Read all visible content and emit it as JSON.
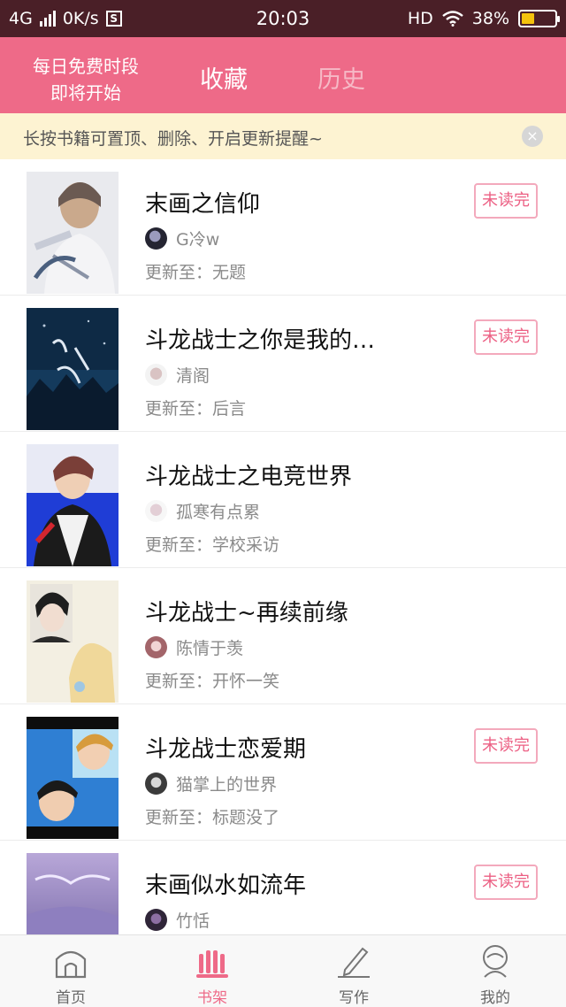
{
  "status_bar": {
    "network": "4G",
    "speed": "0K/s",
    "notif_glyph": "S",
    "time": "20:03",
    "hd": "HD",
    "battery": "38%",
    "battery_level": 0.38
  },
  "header": {
    "promo_line1": "每日免费时段",
    "promo_line2": "即将开始",
    "tabs": [
      {
        "label": "收藏",
        "active": true
      },
      {
        "label": "历史",
        "active": false
      }
    ]
  },
  "notice": {
    "text": "长按书籍可置顶、删除、开启更新提醒~",
    "close_glyph": "×"
  },
  "books": [
    {
      "title": "末画之信仰",
      "author": "G冷w",
      "update": "更新至：无题",
      "badge": "未读完"
    },
    {
      "title": "斗龙战士之你是我的…",
      "author": "清阁",
      "update": "更新至：后言",
      "badge": "未读完"
    },
    {
      "title": "斗龙战士之电竞世界",
      "author": "孤寒有点累",
      "update": "更新至：学校采访",
      "badge": ""
    },
    {
      "title": "斗龙战士~再续前缘",
      "author": "陈情于羡",
      "update": "更新至：开怀一笑",
      "badge": ""
    },
    {
      "title": "斗龙战士恋爱期",
      "author": "猫掌上的世界",
      "update": "更新至：标题没了",
      "badge": "未读完"
    },
    {
      "title": "末画似水如流年",
      "author": "竹恬",
      "update": "",
      "badge": "未读完"
    }
  ],
  "bottom_nav": [
    {
      "label": "首页",
      "icon": "home-icon"
    },
    {
      "label": "书架",
      "icon": "bookshelf-icon"
    },
    {
      "label": "写作",
      "icon": "pen-icon"
    },
    {
      "label": "我的",
      "icon": "profile-icon"
    }
  ],
  "colors": {
    "accent": "#ee6a88",
    "status_bar": "#4a1f27",
    "notice_bg": "#fdf3d2",
    "badge_text": "#ec5f83",
    "inactive_tab": "#f6b9c6"
  }
}
